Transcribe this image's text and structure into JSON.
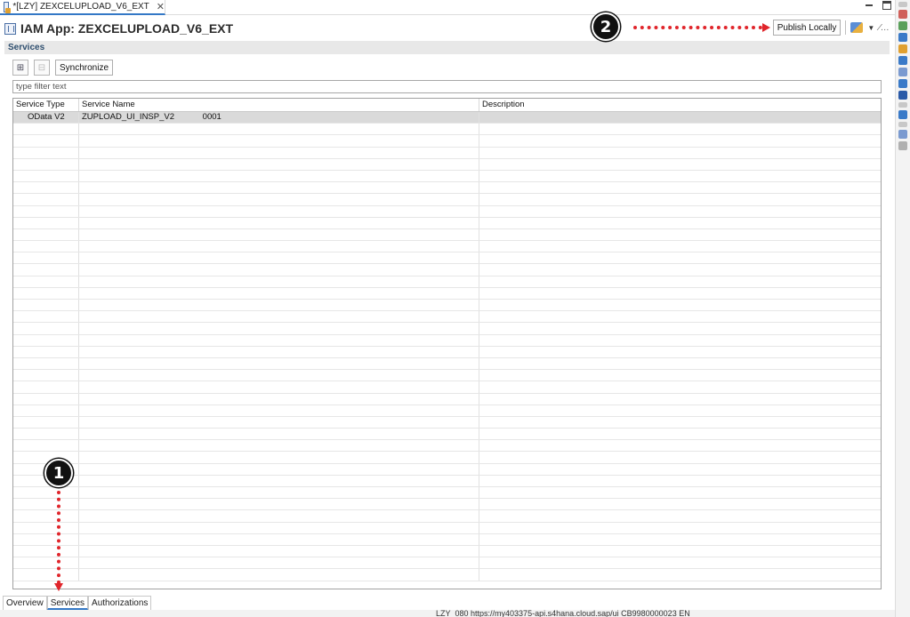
{
  "editor_tab": {
    "title": "*[LZY] ZEXCELUPLOAD_V6_EXT",
    "close": "✕"
  },
  "header": {
    "title": "IAM App: ZEXCELUPLOAD_V6_EXT",
    "publish_label": "Publish Locally",
    "more": "⁄…"
  },
  "section": {
    "title": "Services"
  },
  "toolbar": {
    "synchronize_label": "Synchronize",
    "add_icon": "⊞",
    "remove_icon": "⊟"
  },
  "filter": {
    "placeholder": "type filter text",
    "value": ""
  },
  "table": {
    "columns": [
      "Service Type",
      "Service Name",
      "Description"
    ],
    "rows": [
      {
        "type": "OData V2",
        "name": "ZUPLOAD_UI_INSP_V2            0001",
        "description": ""
      }
    ]
  },
  "page_tabs": [
    "Overview",
    "Services",
    "Authorizations"
  ],
  "active_page_tab": "Services",
  "status_bar": {
    "text": "LZY_080  https://my403375-api.s4hana.cloud.sap/ui  CB9980000023  EN"
  },
  "annotations": {
    "marker_1": "1",
    "marker_2": "2"
  },
  "colors": {
    "accent": "#3478c6",
    "annotation": "#e0252b",
    "section_bar": "#e8e8e8",
    "selected_row": "#dadada"
  }
}
